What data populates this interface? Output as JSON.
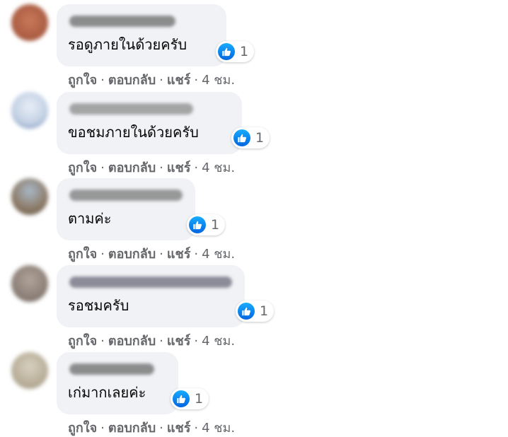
{
  "colors": {
    "bubble_bg": "#f0f2f5",
    "like_blue": "#1877f2",
    "meta_text": "#65676b",
    "body_text": "#050505"
  },
  "actions": {
    "like": "ถูกใจ",
    "reply": "ตอบกลับ",
    "share": "แชร์",
    "separator": "·"
  },
  "comments": [
    {
      "text": "รอดูภายในด้วยครับ",
      "likes": "1",
      "time": "4 ชม.",
      "reaction_icon": "like-icon"
    },
    {
      "text": "ขอชมภายในด้วยครับ",
      "likes": "1",
      "time": "4 ชม.",
      "reaction_icon": "like-icon"
    },
    {
      "text": "ตามค่ะ",
      "likes": "1",
      "time": "4 ชม.",
      "reaction_icon": "like-icon"
    },
    {
      "text": "รอชมครับ",
      "likes": "1",
      "time": "4 ชม.",
      "reaction_icon": "like-icon"
    },
    {
      "text": "เก่มากเลยค่ะ",
      "likes": "1",
      "time": "4 ชม.",
      "reaction_icon": "like-icon"
    }
  ]
}
